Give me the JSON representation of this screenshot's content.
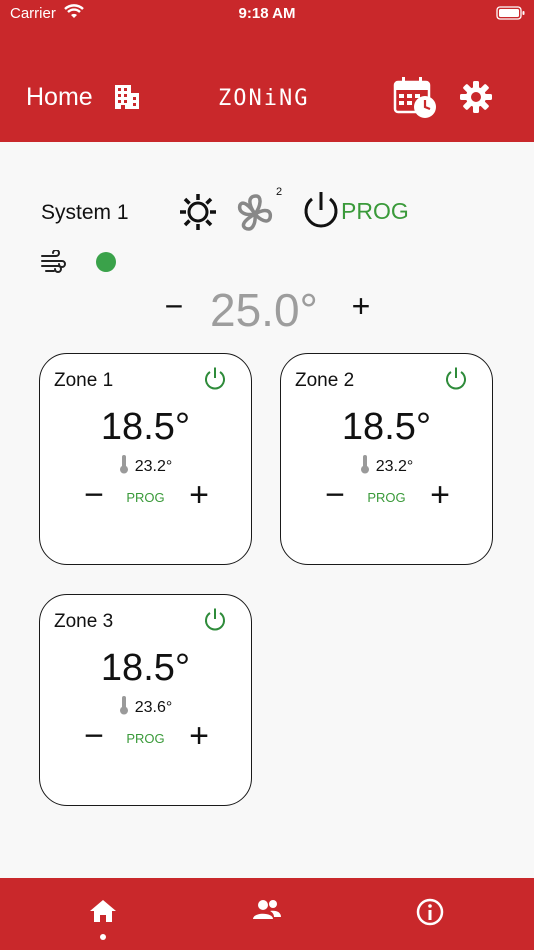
{
  "status_bar": {
    "carrier": "Carrier",
    "time": "9:18 AM"
  },
  "header": {
    "home_label": "Home",
    "brand": "ZONiNG",
    "icons": [
      "building-icon",
      "calendar-clock-icon",
      "gear-icon"
    ]
  },
  "system": {
    "name": "System 1",
    "mode_icon": "sun-icon",
    "fan_icon": "fan-icon",
    "fan_speed": "2",
    "power_icon": "power-icon",
    "program_label": "PROG",
    "airflow_icon": "wind-icon",
    "status_color": "#3aa24a",
    "setpoint": {
      "minus": "−",
      "value": "25.0°",
      "plus": "+"
    }
  },
  "zones": [
    {
      "name": "Zone 1",
      "setpoint": "18.5°",
      "current": "23.2°",
      "program_label": "PROG",
      "minus": "−",
      "plus": "+"
    },
    {
      "name": "Zone 2",
      "setpoint": "18.5°",
      "current": "23.2°",
      "program_label": "PROG",
      "minus": "−",
      "plus": "+"
    },
    {
      "name": "Zone 3",
      "setpoint": "18.5°",
      "current": "23.6°",
      "program_label": "PROG",
      "minus": "−",
      "plus": "+"
    }
  ],
  "tabbar": {
    "tabs": [
      "home-icon",
      "users-icon",
      "info-icon"
    ],
    "active": "home-icon"
  },
  "colors": {
    "brand_red": "#c9282b",
    "accent_green": "#3a9a3a",
    "setpoint_gray": "#9d9d9d"
  }
}
